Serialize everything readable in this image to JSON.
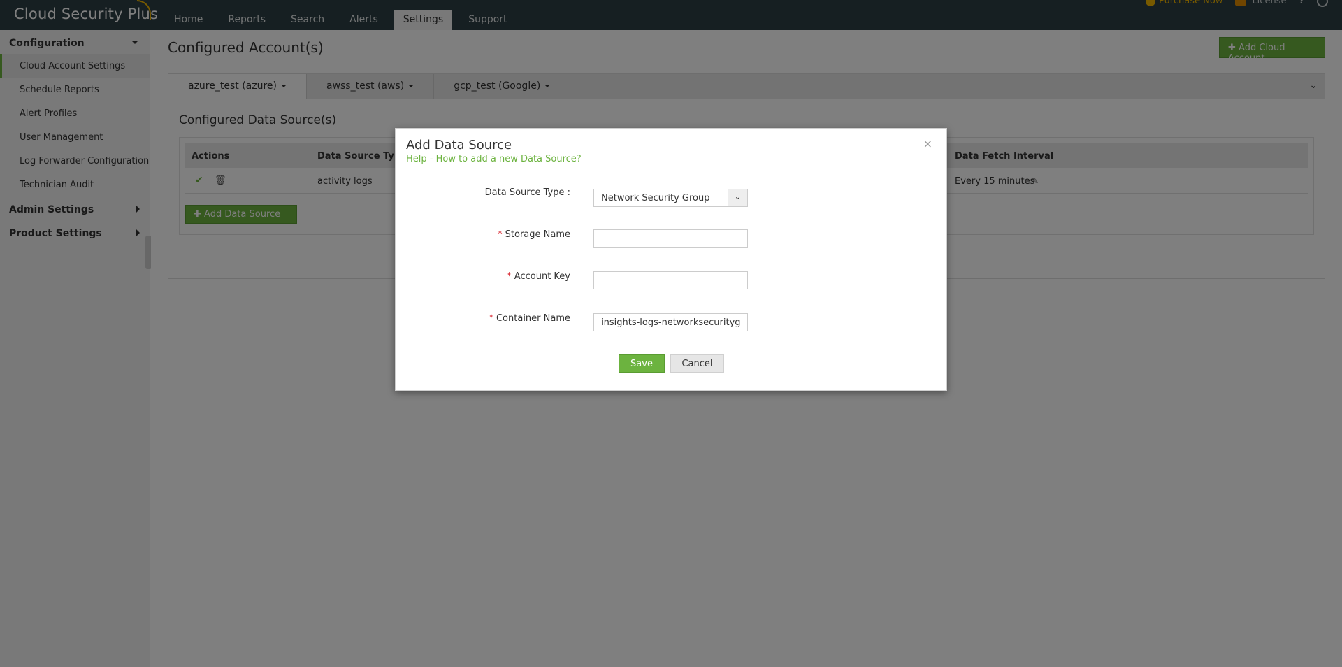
{
  "app": {
    "logo_main": "Cloud Security",
    "logo_plus": "Plus"
  },
  "nav": [
    {
      "label": "Home"
    },
    {
      "label": "Reports"
    },
    {
      "label": "Search"
    },
    {
      "label": "Alerts"
    },
    {
      "label": "Settings",
      "active": true
    },
    {
      "label": "Support"
    }
  ],
  "header_right": {
    "purchase": "Purchase Now",
    "license": "License",
    "help": "?"
  },
  "sidebar": {
    "configuration": "Configuration",
    "items": [
      {
        "label": "Cloud Account Settings",
        "active": true
      },
      {
        "label": "Schedule Reports"
      },
      {
        "label": "Alert Profiles"
      },
      {
        "label": "User Management"
      },
      {
        "label": "Log Forwarder Configuration"
      },
      {
        "label": "Technician Audit"
      }
    ],
    "admin_settings": "Admin Settings",
    "product_settings": "Product Settings"
  },
  "main": {
    "title": "Configured Account(s)",
    "add_cloud_label": "Add Cloud Account",
    "tabs": [
      {
        "label": "azure_test (azure)",
        "active": true
      },
      {
        "label": "awss_test (aws)"
      },
      {
        "label": "gcp_test (Google)"
      }
    ],
    "section_title": "Configured Data Source(s)",
    "table": {
      "headers": {
        "actions": "Actions",
        "type": "Data Source Type",
        "interval": "Data Fetch Interval"
      },
      "row": {
        "type": "activity logs",
        "interval": "Every 15 minutes"
      }
    },
    "add_ds_label": "Add Data Source"
  },
  "modal": {
    "title": "Add Data Source",
    "help": "Help - How to add a new Data Source?",
    "type_label": "Data Source Type :",
    "type_value": "Network Security Group",
    "storage_label": "Storage Name",
    "storage_value": "",
    "account_key_label": "Account Key",
    "account_key_value": "",
    "container_label": "Container Name",
    "container_value": "insights-logs-networksecuritygroupflowevent",
    "required_mark": "*",
    "save": "Save",
    "cancel": "Cancel",
    "close": "×"
  },
  "colors": {
    "accent": "#6cb33f",
    "header_bg": "#2c3e44",
    "required": "#d9232d"
  }
}
